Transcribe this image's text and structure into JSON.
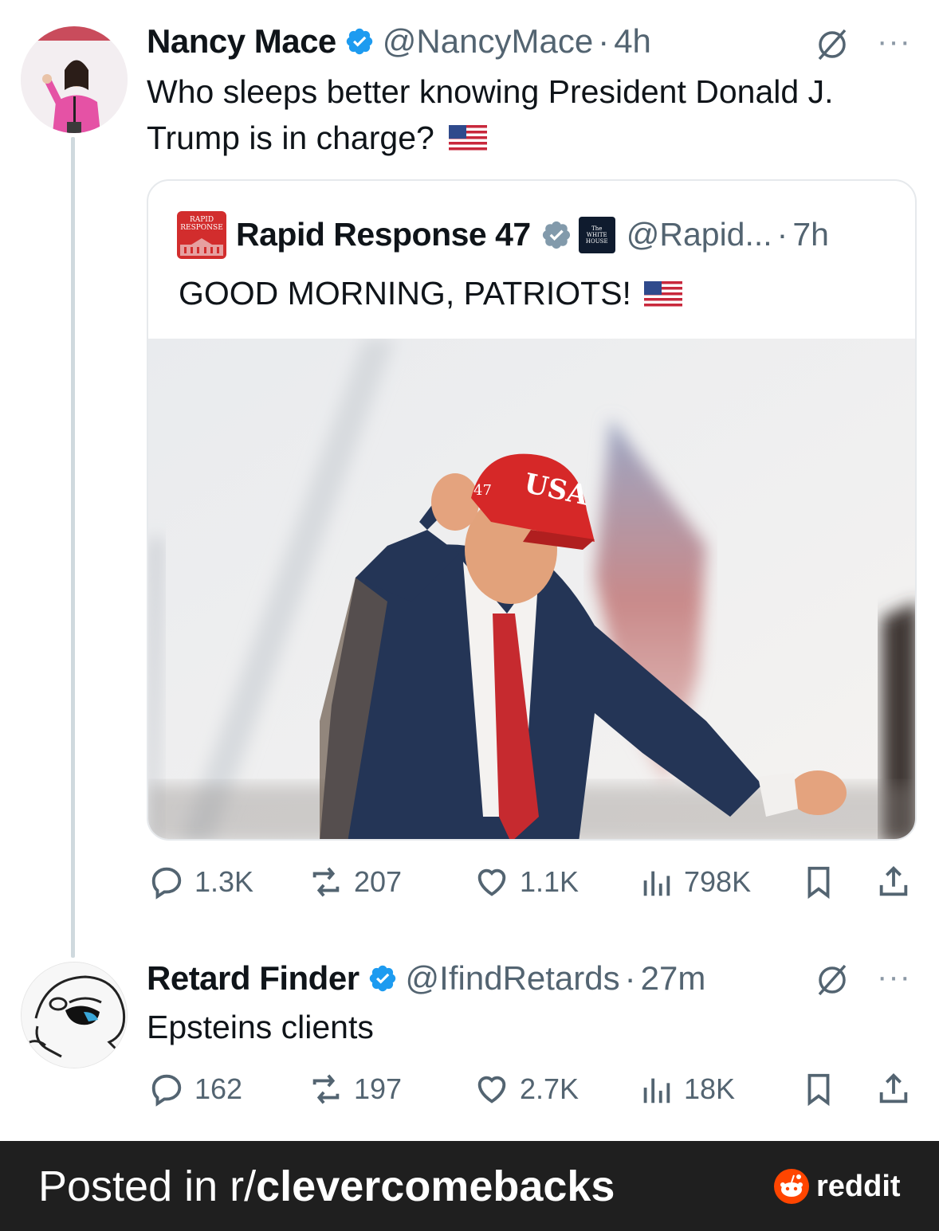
{
  "tweet": {
    "author_name": "Nancy Mace",
    "author_handle": "@NancyMace",
    "separator": "·",
    "time": "4h",
    "more": "···",
    "text_line1": "Who sleeps better knowing President Donald J.",
    "text_line2": "Trump is in charge?",
    "quoted": {
      "author_name": "Rapid Response 47",
      "author_handle": "@Rapid...",
      "separator": "·",
      "time": "7h",
      "text": "GOOD MORNING, PATRIOTS!",
      "avatar_text_top": "RAPID",
      "avatar_text_bottom": "RESPONSE",
      "affiliate_badge_top": "The",
      "affiliate_badge_mid": "WHITE",
      "affiliate_badge_bot": "HOUSE",
      "photo_hat_text": "USA",
      "photo_hat_side": "47"
    },
    "stats": {
      "replies": "1.3K",
      "reposts": "207",
      "likes": "1.1K",
      "views": "798K"
    }
  },
  "reply": {
    "author_name": "Retard Finder",
    "author_handle": "@IfindRetards",
    "separator": "·",
    "time": "27m",
    "more": "···",
    "text": "Epsteins clients",
    "stats": {
      "replies": "162",
      "reposts": "197",
      "likes": "2.7K",
      "views": "18K"
    }
  },
  "footer": {
    "prefix": "Posted in r/",
    "subreddit": "clevercomebacks",
    "brand": "reddit"
  },
  "colors": {
    "verified_blue": "#1d9bf0",
    "handle_gray": "#536471",
    "footer_bg": "#1f1f1f",
    "reddit_orange": "#ff4500",
    "hat_red": "#d62828"
  }
}
